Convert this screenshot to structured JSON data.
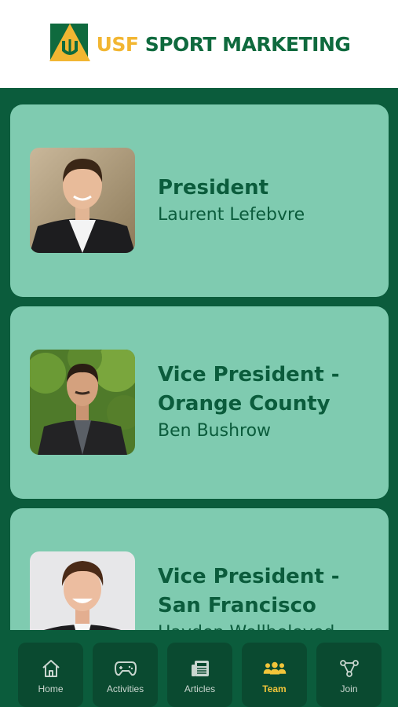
{
  "header": {
    "logo_usf": "USF",
    "logo_rest": "SPORT MARKETING"
  },
  "team": [
    {
      "role": "President",
      "name": "Laurent Lefebvre"
    },
    {
      "role": "Vice President - Orange County",
      "name": "Ben Bushrow"
    },
    {
      "role": "Vice President - San Francisco",
      "name": "Hayden Wellbeloved"
    }
  ],
  "tabs": [
    {
      "label": "Home",
      "icon": "home-icon"
    },
    {
      "label": "Activities",
      "icon": "gamepad-icon"
    },
    {
      "label": "Articles",
      "icon": "newspaper-icon"
    },
    {
      "label": "Team",
      "icon": "team-icon",
      "active": true
    },
    {
      "label": "Join",
      "icon": "share-icon"
    }
  ],
  "colors": {
    "dark_green": "#0b5c3c",
    "card_green": "#7fcbb0",
    "tab_bg": "#0a4a30",
    "gold": "#f2c53a"
  }
}
